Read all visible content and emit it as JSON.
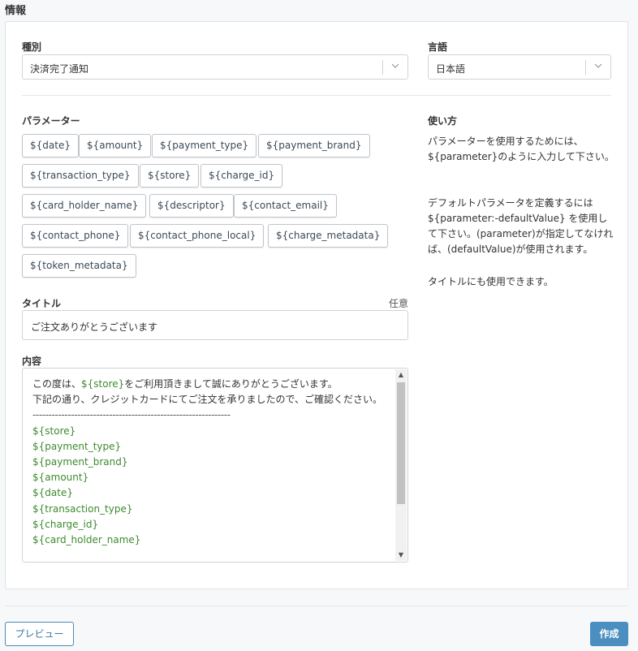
{
  "section": {
    "title": "情報"
  },
  "type_field": {
    "label": "種別",
    "value": "決済完了通知"
  },
  "language_field": {
    "label": "言語",
    "value": "日本語"
  },
  "parameters": {
    "label": "パラメーター",
    "items": [
      "${date}",
      "${amount}",
      "${payment_type}",
      "${payment_brand}",
      "${transaction_type}",
      "${store}",
      "${charge_id}",
      "${card_holder_name}",
      "${descriptor}",
      "${contact_email}",
      "${contact_phone}",
      "${contact_phone_local}",
      "${charge_metadata}",
      "${token_metadata}"
    ]
  },
  "title_field": {
    "label": "タイトル",
    "optional": "任意",
    "value": "ご注文ありがとうございます"
  },
  "content_field": {
    "label": "内容",
    "lines": {
      "l1_pre": "この度は、",
      "l1_var": "${store}",
      "l1_post": "をご利用頂きまして誠にありがとうございます。",
      "l2": "下記の通り、クレジットカードにてご注文を承りましたので、ご確認ください。",
      "dashes": "--------------------------------------------------------------",
      "vars": [
        "${store}",
        "${payment_type}",
        "${payment_brand}",
        "${amount}",
        "${date}",
        "${transaction_type}",
        "${charge_id}",
        "${card_holder_name}"
      ]
    }
  },
  "help": {
    "title": "使い方",
    "p1": "パラメーターを使用するためには、${parameter}のように入力して下さい。",
    "p2": "デフォルトパラメータを定義するには${parameter:-defaultValue} を使用して下さい。(parameter)が指定してなければ、(defaultValue)が使用されます。",
    "p3": "タイトルにも使用できます。"
  },
  "footer": {
    "preview_label": "プレビュー",
    "create_label": "作成"
  }
}
